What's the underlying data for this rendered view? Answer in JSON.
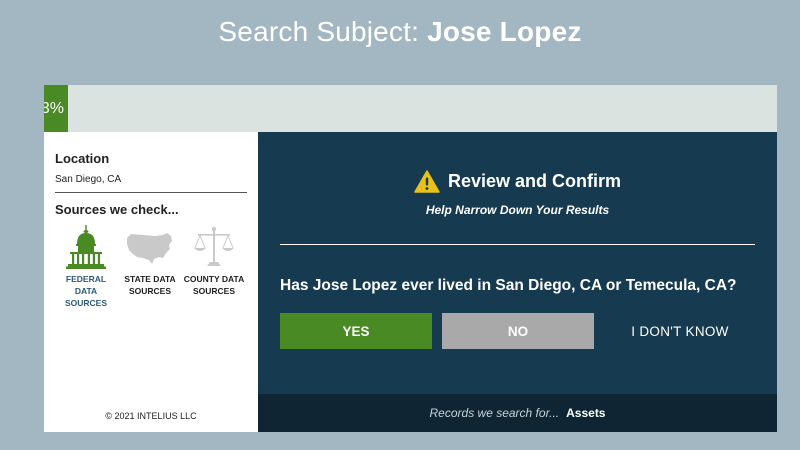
{
  "header": {
    "label": "Search Subject:",
    "subject_name": "Jose Lopez"
  },
  "progress": {
    "text": "3%",
    "percent": 3
  },
  "sidebar": {
    "location_title": "Location",
    "location_value": "San Diego, CA",
    "sources_title": "Sources we check...",
    "sources": [
      {
        "line1": "FEDERAL DATA",
        "line2": "SOURCES",
        "icon": "capitol-icon",
        "active": true
      },
      {
        "line1": "STATE DATA",
        "line2": "SOURCES",
        "icon": "usa-map-icon",
        "active": false
      },
      {
        "line1": "COUNTY DATA",
        "line2": "SOURCES",
        "icon": "scales-of-justice-icon",
        "active": false
      }
    ],
    "copyright": "© 2021 INTELIUS LLC"
  },
  "main": {
    "title": "Review and Confirm",
    "subtitle": "Help Narrow Down Your Results",
    "question": "Has Jose Lopez ever lived in San Diego, CA or Temecula, CA?",
    "buttons": {
      "yes": "YES",
      "no": "NO",
      "dont_know": "I DON'T KNOW"
    }
  },
  "footer": {
    "prefix": "Records we search for...",
    "value": "Assets"
  },
  "colors": {
    "background": "#a3b7c2",
    "panel": "#163a4f",
    "accent_green": "#4a8a24",
    "button_gray": "#a9a9a9",
    "warning_yellow": "#e8c21a"
  }
}
